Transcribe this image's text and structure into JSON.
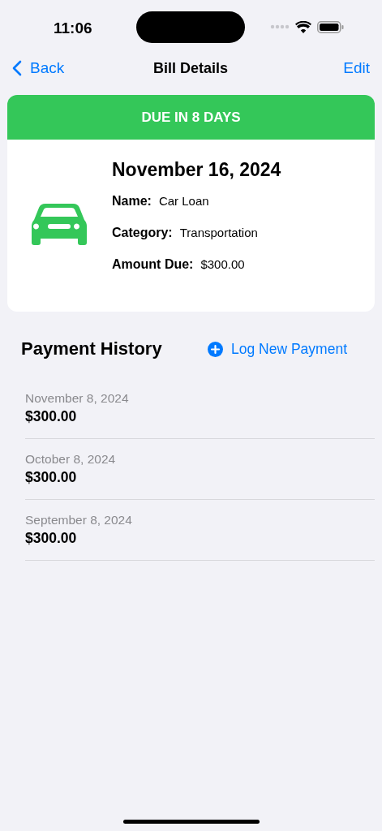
{
  "status_bar": {
    "time": "11:06"
  },
  "nav": {
    "back": "Back",
    "title": "Bill Details",
    "action": "Edit"
  },
  "bill": {
    "banner": "DUE IN 8 DAYS",
    "date": "November 16, 2024",
    "fields": [
      {
        "label": "Name:",
        "value": "Car Loan"
      },
      {
        "label": "Category:",
        "value": "Transportation"
      },
      {
        "label": "Amount Due:",
        "value": "$300.00"
      }
    ]
  },
  "history": {
    "title": "Payment History",
    "action": "Log New Payment",
    "payments": [
      {
        "date": "November 8, 2024",
        "amount": "$300.00"
      },
      {
        "date": "October 8, 2024",
        "amount": "$300.00"
      },
      {
        "date": "September 8, 2024",
        "amount": "$300.00"
      }
    ]
  }
}
